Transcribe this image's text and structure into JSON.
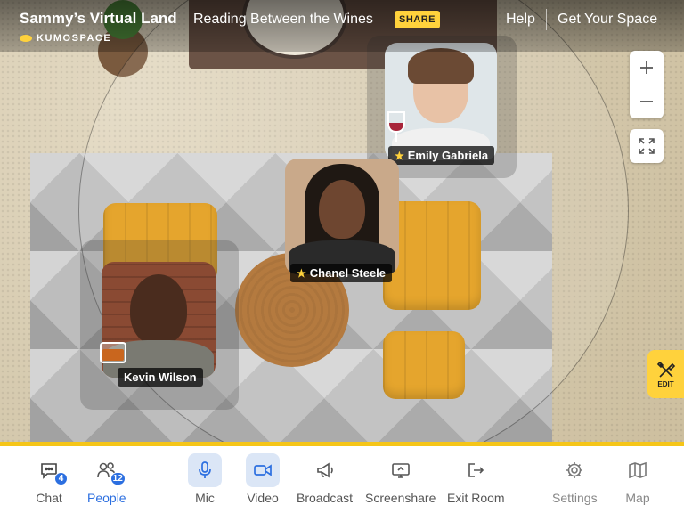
{
  "header": {
    "space_name": "Sammy’s Virtual Land",
    "brand": "KUMOSPACE",
    "room_name": "Reading Between the Wines",
    "share_label": "SHARE",
    "help_label": "Help",
    "get_space_label": "Get Your Space"
  },
  "map_controls": {
    "zoom_in_icon": "plus-icon",
    "zoom_out_icon": "minus-icon",
    "fullscreen_icon": "expand-icon",
    "edit_label": "EDIT"
  },
  "participants": [
    {
      "name": "Emily Gabriela",
      "starred": true,
      "has_drink": "wine-glass"
    },
    {
      "name": "Chanel Steele",
      "starred": true
    },
    {
      "name": "Kevin Wilson",
      "starred": false,
      "has_drink": "whiskey-glass"
    }
  ],
  "toolbar": {
    "chat": {
      "label": "Chat",
      "badge": "4",
      "icon": "chat-icon"
    },
    "people": {
      "label": "People",
      "badge": "12",
      "icon": "people-icon"
    },
    "mic": {
      "label": "Mic",
      "icon": "mic-icon"
    },
    "video": {
      "label": "Video",
      "icon": "video-icon"
    },
    "broadcast": {
      "label": "Broadcast",
      "icon": "megaphone-icon"
    },
    "screenshare": {
      "label": "Screenshare",
      "icon": "screenshare-icon"
    },
    "exit": {
      "label": "Exit Room",
      "icon": "exit-icon"
    },
    "settings": {
      "label": "Settings",
      "icon": "gear-icon"
    },
    "map": {
      "label": "Map",
      "icon": "map-icon"
    }
  },
  "colors": {
    "accent": "#ffd23c",
    "active_blue": "#2c6fe0",
    "toolbar_border": "#f5c518"
  }
}
